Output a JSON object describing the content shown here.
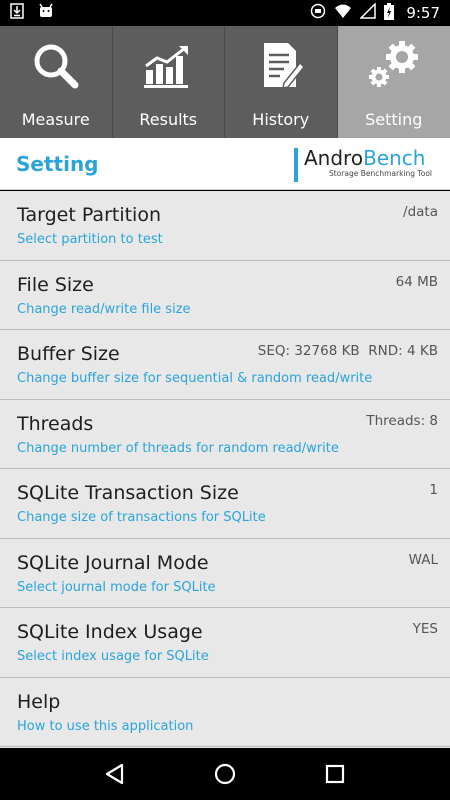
{
  "status_bar": {
    "time": "9:57",
    "icons_left": [
      "download-icon",
      "android-icon"
    ],
    "icons_right": [
      "sync-icon",
      "wifi-icon",
      "signal-icon",
      "battery-icon"
    ]
  },
  "tabs": [
    {
      "label": "Measure",
      "icon": "search-icon",
      "active": false
    },
    {
      "label": "Results",
      "icon": "chart-icon",
      "active": false
    },
    {
      "label": "History",
      "icon": "document-icon",
      "active": false
    },
    {
      "label": "Setting",
      "icon": "gear-icon",
      "active": true
    }
  ],
  "header": {
    "title": "Setting",
    "logo_part1": "Andro",
    "logo_part2": "Bench",
    "logo_subtitle": "Storage Benchmarking Tool"
  },
  "settings": [
    {
      "title": "Target Partition",
      "subtitle": "Select partition to test",
      "value": "/data"
    },
    {
      "title": "File Size",
      "subtitle": "Change read/write file size",
      "value": "64 MB"
    },
    {
      "title": "Buffer Size",
      "subtitle": "Change buffer size for sequential & random read/write",
      "value": "SEQ: 32768 KB  RND: 4 KB"
    },
    {
      "title": "Threads",
      "subtitle": "Change number of threads for random read/write",
      "value": "Threads: 8"
    },
    {
      "title": "SQLite Transaction Size",
      "subtitle": "Change size of transactions for SQLite",
      "value": "1"
    },
    {
      "title": "SQLite Journal Mode",
      "subtitle": "Select journal mode for SQLite",
      "value": "WAL"
    },
    {
      "title": "SQLite Index Usage",
      "subtitle": "Select index usage for SQLite",
      "value": "YES"
    },
    {
      "title": "Help",
      "subtitle": "How to use this application",
      "value": ""
    }
  ],
  "colors": {
    "accent": "#2aa4d9",
    "tab_bg": "#5d5d5d",
    "tab_active_bg": "#a6a6a6",
    "list_bg": "#e8e8e8"
  }
}
